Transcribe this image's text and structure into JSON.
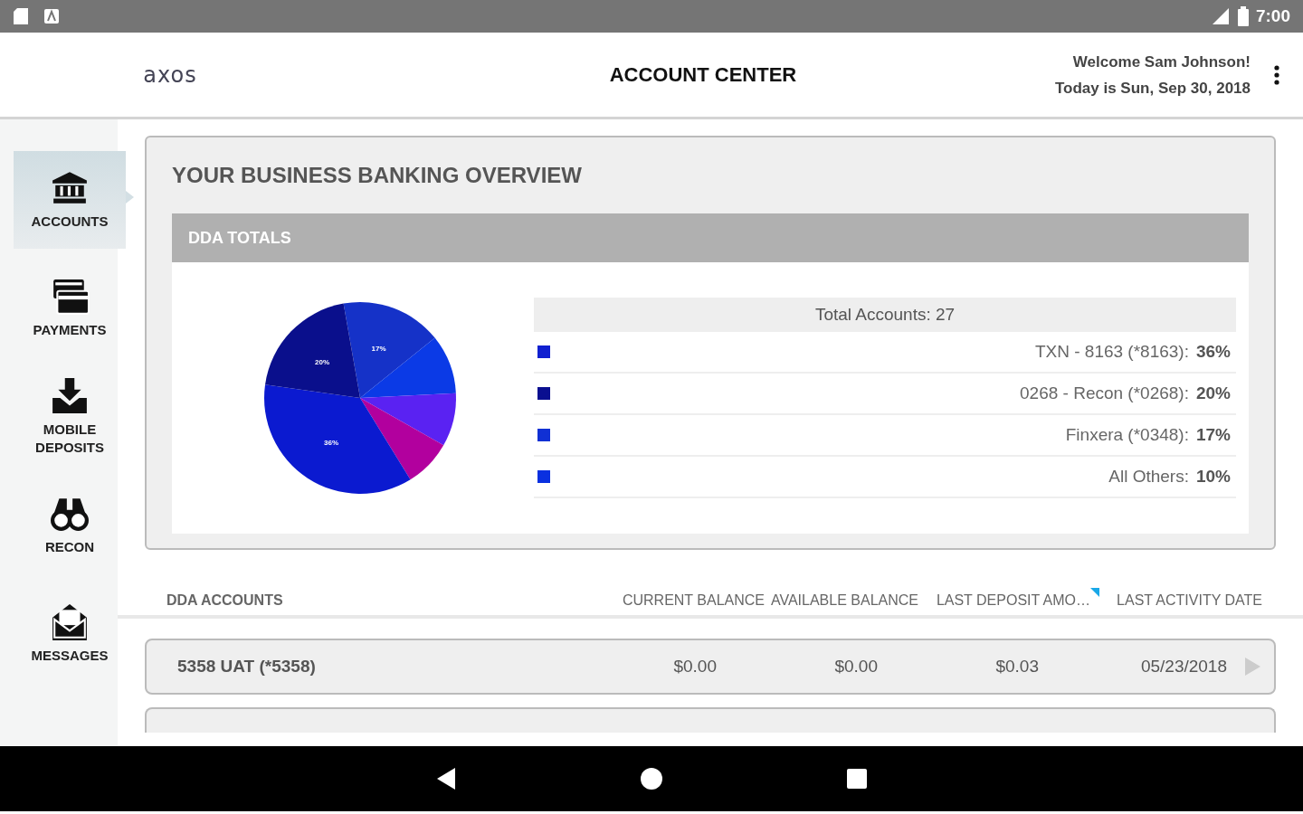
{
  "status_bar": {
    "time": "7:00"
  },
  "header": {
    "logo": "axos",
    "title": "ACCOUNT CENTER",
    "welcome": "Welcome Sam Johnson!",
    "date": "Today is Sun, Sep 30, 2018"
  },
  "sidebar": {
    "items": [
      {
        "label": "ACCOUNTS",
        "selected": true
      },
      {
        "label": "PAYMENTS",
        "selected": false
      },
      {
        "label": "MOBILE DEPOSITS",
        "selected": false
      },
      {
        "label": "RECON",
        "selected": false
      },
      {
        "label": "MESSAGES",
        "selected": false
      }
    ]
  },
  "overview": {
    "title": "YOUR BUSINESS BANKING OVERVIEW",
    "panel_title": "DDA TOTALS",
    "chart_data": {
      "type": "pie",
      "values": [
        17,
        10,
        9,
        8,
        36,
        20
      ],
      "colors": [
        "#1532c8",
        "#0b3ae6",
        "#5a22f2",
        "#b2009e",
        "#0b1ad0",
        "#0a0f8c"
      ],
      "value_labels": [
        "17%",
        null,
        null,
        null,
        "36%",
        "20%"
      ]
    },
    "total": "Total Accounts: 27",
    "legend": [
      {
        "name": "TXN - 8163 (*8163):",
        "share": "36%",
        "color": "#1020d0"
      },
      {
        "name": "0268 - Recon (*0268):",
        "share": "20%",
        "color": "#0a0f90"
      },
      {
        "name": "Finxera (*0348):",
        "share": "17%",
        "color": "#1030d4"
      },
      {
        "name": "All Others:",
        "share": "10%",
        "color": "#0a30e0"
      }
    ]
  },
  "table": {
    "columns": [
      "DDA ACCOUNTS",
      "CURRENT BALANCE",
      "AVAILABLE BALANCE",
      "LAST DEPOSIT AMO…",
      "LAST ACTIVITY DATE"
    ],
    "rows": [
      {
        "name": "5358 UAT (*5358)",
        "current": "$0.00",
        "available": "$0.00",
        "last_deposit": "$0.03",
        "last_activity": "05/23/2018"
      }
    ]
  }
}
